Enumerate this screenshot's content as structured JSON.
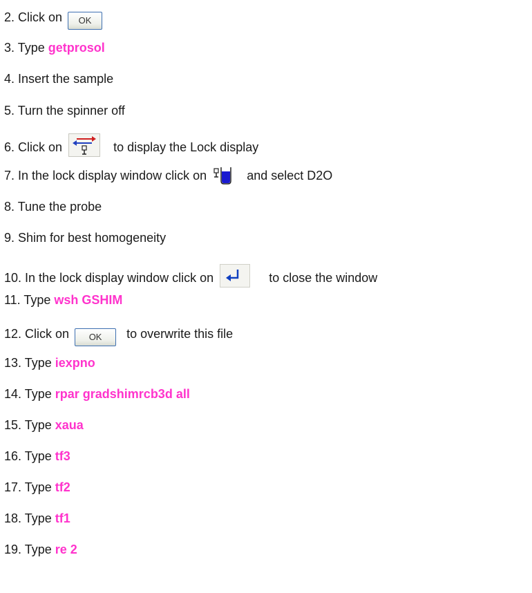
{
  "steps": [
    {
      "num": "2.",
      "text": "Click on",
      "button": "OK"
    },
    {
      "num": "3.",
      "text": "Type",
      "cmd": "getprosol"
    },
    {
      "num": "4.",
      "text": "Insert the sample"
    },
    {
      "num": "5.",
      "text": "Turn the spinner off"
    },
    {
      "num": "6.",
      "text": "Click on",
      "icon": "lock-display-icon",
      "after": "to display the Lock display"
    },
    {
      "num": "7.",
      "text": "In the lock display window click on",
      "icon": "lock-solvent-icon",
      "after": "and select D2O"
    },
    {
      "num": "8.",
      "text": "Tune the probe"
    },
    {
      "num": "9.",
      "text": "Shim for best homogeneity"
    },
    {
      "num": "10.",
      "text": "In the lock display window click on",
      "icon": "return-arrow-icon",
      "after": "to close the window"
    },
    {
      "num": "11.",
      "text": "Type",
      "cmd": "wsh GSHIM"
    },
    {
      "num": "12.",
      "text": "Click on",
      "button": "OK",
      "after": "to overwrite this file"
    },
    {
      "num": "13.",
      "text": "Type",
      "cmd": "iexpno"
    },
    {
      "num": "14.",
      "text": "Type",
      "cmd": "rpar gradshimrcb3d all"
    },
    {
      "num": "15.",
      "text": "Type",
      "cmd": "xaua"
    },
    {
      "num": "16.",
      "text": "Type",
      "cmd": "tf3"
    },
    {
      "num": "17.",
      "text": "Type",
      "cmd": "tf2"
    },
    {
      "num": "18.",
      "text": "Type",
      "cmd": "tf1"
    },
    {
      "num": "19.",
      "text": "Type",
      "cmd": "re 2"
    }
  ],
  "colors": {
    "command": "#ff33cc",
    "text": "#1a1a1a",
    "button_border": "#3d6fb0"
  }
}
